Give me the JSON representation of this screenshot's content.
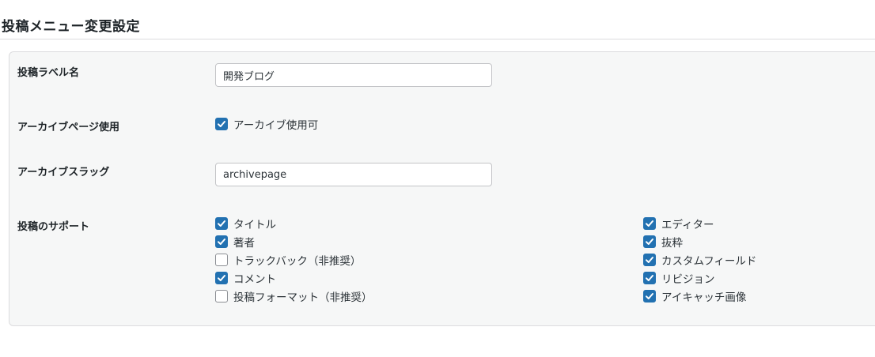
{
  "page_title": "投稿メニュー変更設定",
  "fields": {
    "label_name": {
      "label": "投稿ラベル名",
      "value": "開発ブログ"
    },
    "archive_use": {
      "label": "アーカイブページ使用",
      "checkbox_label": "アーカイブ使用可",
      "checked": true
    },
    "archive_slug": {
      "label": "アーカイブスラッグ",
      "value": "archivepage"
    },
    "supports": {
      "label": "投稿のサポート",
      "left": [
        {
          "label": "タイトル",
          "checked": true
        },
        {
          "label": "著者",
          "checked": true
        },
        {
          "label": "トラックバック（非推奨）",
          "checked": false
        },
        {
          "label": "コメント",
          "checked": true
        },
        {
          "label": "投稿フォーマット（非推奨）",
          "checked": false
        }
      ],
      "right": [
        {
          "label": "エディター",
          "checked": true
        },
        {
          "label": "抜粋",
          "checked": true
        },
        {
          "label": "カスタムフィールド",
          "checked": true
        },
        {
          "label": "リビジョン",
          "checked": true
        },
        {
          "label": "アイキャッチ画像",
          "checked": true
        }
      ]
    }
  },
  "colors": {
    "accent": "#2271b1",
    "panel_bg": "#f6f7f7",
    "border": "#dcdcde"
  },
  "icons": {
    "checked": "checkmark-icon"
  }
}
